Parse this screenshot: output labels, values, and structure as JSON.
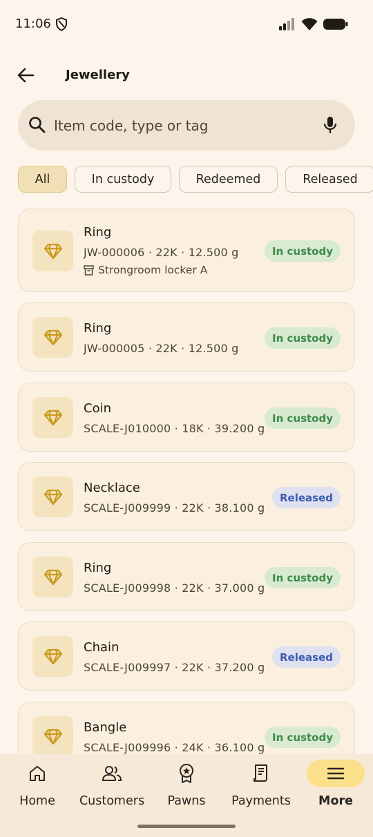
{
  "status_bar": {
    "time": "11:06"
  },
  "app_bar": {
    "title": "Jewellery"
  },
  "search": {
    "placeholder": "Item code, type or tag"
  },
  "filters": [
    {
      "label": "All",
      "selected": true
    },
    {
      "label": "In custody",
      "selected": false
    },
    {
      "label": "Redeemed",
      "selected": false
    },
    {
      "label": "Released",
      "selected": false
    }
  ],
  "items": [
    {
      "name": "Ring",
      "meta": "JW-000006 · 22K · 12.500 g",
      "location": "Strongroom locker A",
      "status": "In custody"
    },
    {
      "name": "Ring",
      "meta": "JW-000005 · 22K · 12.500 g",
      "status": "In custody"
    },
    {
      "name": "Coin",
      "meta": "SCALE-J010000 · 18K · 39.200 g",
      "status": "In custody"
    },
    {
      "name": "Necklace",
      "meta": "SCALE-J009999 · 22K · 38.100 g",
      "status": "Released"
    },
    {
      "name": "Ring",
      "meta": "SCALE-J009998 · 22K · 37.000 g",
      "status": "In custody"
    },
    {
      "name": "Chain",
      "meta": "SCALE-J009997 · 22K · 37.200 g",
      "status": "Released"
    },
    {
      "name": "Bangle",
      "meta": "SCALE-J009996 · 24K · 36.100 g",
      "status": "In custody"
    }
  ],
  "nav": [
    {
      "label": "Home",
      "icon": "home-icon",
      "active": false
    },
    {
      "label": "Customers",
      "icon": "customers-icon",
      "active": false
    },
    {
      "label": "Pawns",
      "icon": "pawns-icon",
      "active": false
    },
    {
      "label": "Payments",
      "icon": "payments-icon",
      "active": false
    },
    {
      "label": "More",
      "icon": "menu-icon",
      "active": true
    }
  ],
  "colors": {
    "background": "#fdf5ec",
    "card": "#fbf0df",
    "accent_gold": "#c99a1e",
    "custody_badge": "#d8ead2",
    "custody_text": "#3e8a4a",
    "released_badge": "#dfe0f0",
    "released_text": "#3b5bb0",
    "nav_active": "#fbe08b"
  }
}
